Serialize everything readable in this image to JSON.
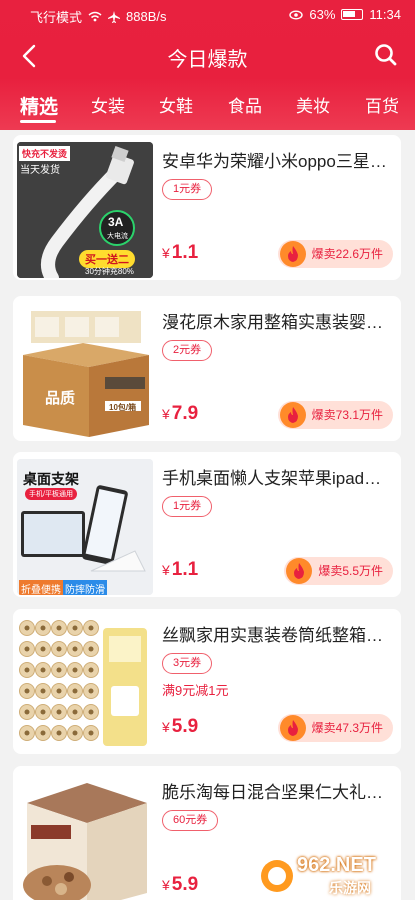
{
  "status": {
    "left": "飞行模式",
    "speed": "888B/s",
    "battery": "63%",
    "time": "11:34"
  },
  "nav": {
    "title": "今日爆款"
  },
  "tabs": [
    "精选",
    "女装",
    "女鞋",
    "食品",
    "美妆",
    "百货"
  ],
  "products": [
    {
      "title": "安卓华为荣耀小米oppo三星…",
      "coupon": "1元券",
      "currency": "¥",
      "price": "1.1",
      "sold": "爆卖22.6万件",
      "thumb": {
        "tag1": "快充不发烫",
        "tag2": "当天发货",
        "speed": "3A",
        "speed_sub": "大电流",
        "badge": "买一送二",
        "footnote": "30分钟充80%"
      }
    },
    {
      "title": "漫花原木家用整箱实惠装婴…",
      "coupon": "2元券",
      "currency": "¥",
      "price": "7.9",
      "sold": "爆卖73.1万件",
      "thumb": {
        "box": "品质",
        "label": "10包/箱"
      }
    },
    {
      "title": "手机桌面懒人支架苹果ipad…",
      "coupon": "1元券",
      "currency": "¥",
      "price": "1.1",
      "sold": "爆卖5.5万件",
      "thumb": {
        "head": "桌面支架",
        "sub": "手机/平板通用",
        "tag1": "折叠便携",
        "tag2": "防摔防滑"
      }
    },
    {
      "title": "丝飘家用实惠装卷筒纸整箱…",
      "coupon": "3元券",
      "promo": "满9元减1元",
      "currency": "¥",
      "price": "5.9",
      "sold": "爆卖47.3万件",
      "thumb": {}
    },
    {
      "title": "脆乐淘每日混合坚果仁大礼…",
      "coupon": "60元券",
      "currency": "¥",
      "price": "5.9",
      "sold": "",
      "thumb": {}
    }
  ],
  "watermark": {
    "text": "962.NET",
    "sub": "乐游网"
  }
}
